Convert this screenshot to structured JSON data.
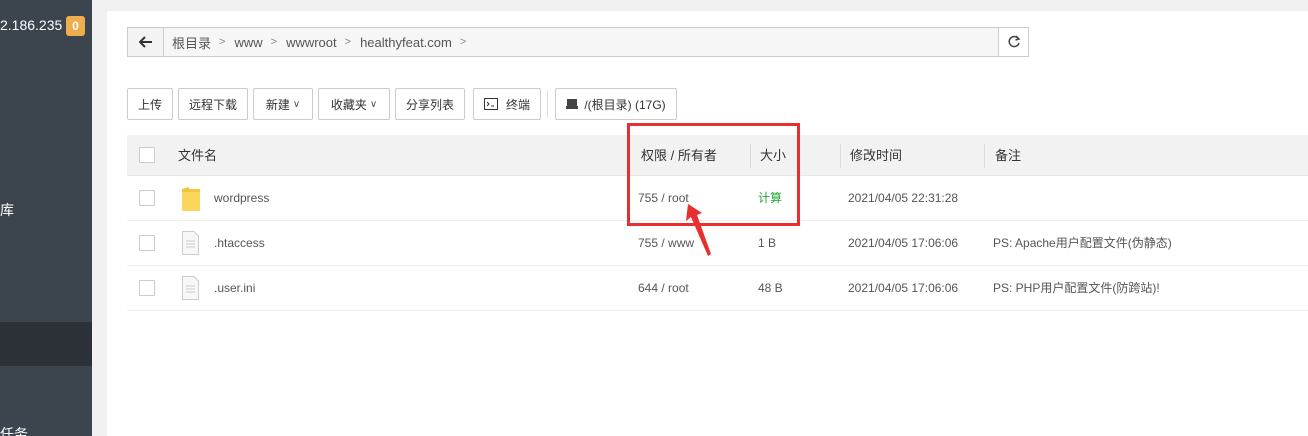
{
  "sidebar": {
    "ip_fragment": "2.186.235",
    "badge": "0",
    "items": [
      "库",
      "任务"
    ]
  },
  "breadcrumb": {
    "items": [
      "根目录",
      "www",
      "wwwroot",
      "healthyfeat.com"
    ]
  },
  "toolbar": {
    "upload": "上传",
    "remote_download": "远程下载",
    "new": "新建",
    "favorites": "收藏夹",
    "share_list": "分享列表",
    "terminal": "终端",
    "disk": "/(根目录) (17G)"
  },
  "table": {
    "headers": {
      "name": "文件名",
      "permission": "权限 / 所有者",
      "size": "大小",
      "mtime": "修改时间",
      "note": "备注"
    },
    "rows": [
      {
        "name": "wordpress",
        "type": "folder",
        "perm": "755 / root",
        "size": "计算",
        "mtime": "2021/04/05 22:31:28",
        "note": ""
      },
      {
        "name": ".htaccess",
        "type": "file",
        "perm": "755 / www",
        "size": "1 B",
        "mtime": "2021/04/05 17:06:06",
        "note": "PS: Apache用户配置文件(伪静态)"
      },
      {
        "name": ".user.ini",
        "type": "file",
        "perm": "644 / root",
        "size": "48 B",
        "mtime": "2021/04/05 17:06:06",
        "note": "PS: PHP用户配置文件(防跨站)!"
      }
    ]
  },
  "colors": {
    "accent_green": "#20a53a",
    "annotation_red": "#e82e2e",
    "sidebar_bg": "#3c444d",
    "badge_orange": "#f0ad4e"
  }
}
